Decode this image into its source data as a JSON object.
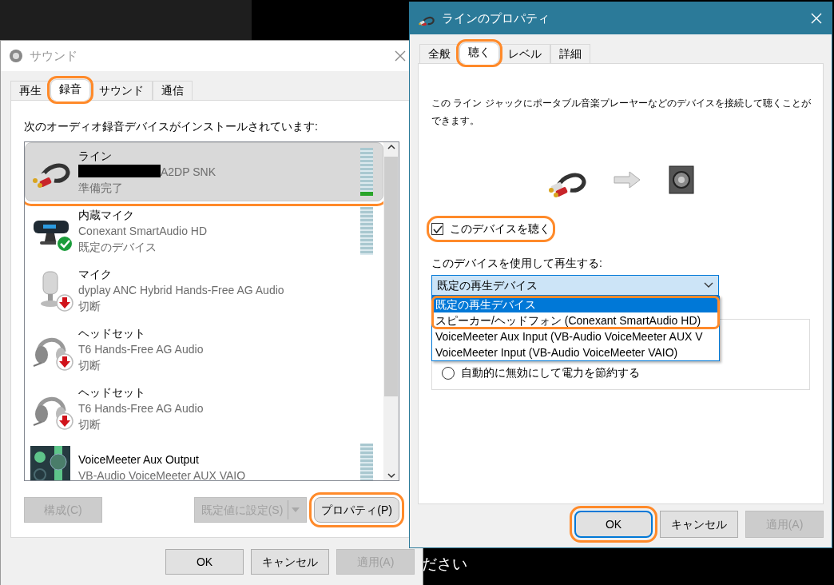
{
  "background_text": "ださい",
  "sound_window": {
    "title": "サウンド",
    "tabs": [
      {
        "label": "再生",
        "selected": false,
        "highlighted": false
      },
      {
        "label": "録音",
        "selected": true,
        "highlighted": true
      },
      {
        "label": "サウンド",
        "selected": false,
        "highlighted": false
      },
      {
        "label": "通信",
        "selected": false,
        "highlighted": false
      }
    ],
    "instruction": "次のオーディオ録音デバイスがインストールされています:",
    "devices": [
      {
        "kind": "line",
        "name": "ライン",
        "description": "A2DP SNK",
        "redacted": true,
        "status": "準備完了",
        "default_device": false,
        "disconnected": false,
        "level": 0.08,
        "selected": true,
        "highlighted": true
      },
      {
        "kind": "webcam",
        "name": "内蔵マイク",
        "description": "Conexant SmartAudio HD",
        "status": "既定のデバイス",
        "default_device": true,
        "disconnected": false,
        "level": 0,
        "selected": false,
        "highlighted": false
      },
      {
        "kind": "mic",
        "name": "マイク",
        "description": "dyplay ANC Hybrid Hands-Free AG Audio",
        "status": "切断",
        "default_device": false,
        "disconnected": true,
        "selected": false,
        "highlighted": false
      },
      {
        "kind": "headset",
        "name": "ヘッドセット",
        "description": "T6 Hands-Free AG Audio",
        "status": "切断",
        "default_device": false,
        "disconnected": true,
        "selected": false,
        "highlighted": false
      },
      {
        "kind": "headset",
        "name": "ヘッドセット",
        "description": "T6 Hands-Free AG Audio",
        "status": "切断",
        "default_device": false,
        "disconnected": true,
        "selected": false,
        "highlighted": false
      },
      {
        "kind": "mixer",
        "name": "VoiceMeeter Aux Output",
        "description": "VB-Audio VoiceMeeter AUX VAIO",
        "default_device": false,
        "disconnected": false,
        "level": 0,
        "selected": false,
        "highlighted": false
      }
    ],
    "list_buttons": [
      {
        "label": "構成(C)",
        "kind": "plain",
        "disabled": true,
        "highlighted": false
      },
      {
        "label": "既定値に設定(S)",
        "kind": "split",
        "disabled": true,
        "highlighted": false
      },
      {
        "label": "プロパティ(P)",
        "kind": "plain",
        "disabled": false,
        "highlighted": true
      }
    ],
    "dialog_buttons": [
      {
        "label": "OK",
        "disabled": false,
        "default": false,
        "highlighted": false
      },
      {
        "label": "キャンセル",
        "disabled": false,
        "default": false,
        "highlighted": false
      },
      {
        "label": "適用(A)",
        "disabled": true,
        "default": false,
        "highlighted": false
      }
    ]
  },
  "properties_window": {
    "title": "ラインのプロパティ",
    "tabs": [
      {
        "label": "全般",
        "selected": false,
        "highlighted": false
      },
      {
        "label": "聴く",
        "selected": true,
        "highlighted": true
      },
      {
        "label": "レベル",
        "selected": false,
        "highlighted": false
      },
      {
        "label": "詳細",
        "selected": false,
        "highlighted": false
      }
    ],
    "description": "この ライン ジャックにポータブル音楽プレーヤーなどのデバイスを接続して聴くことができます。",
    "listen_checkbox": {
      "label": "このデバイスを聴く",
      "checked": true,
      "highlighted": true
    },
    "playback_label": "このデバイスを使用して再生する:",
    "playback_dropdown": {
      "value": "既定の再生デバイス",
      "open": true,
      "options": [
        {
          "label": "既定の再生デバイス",
          "selected": true,
          "highlighted": true
        },
        {
          "label": "スピーカー/ヘッドフォン (Conexant SmartAudio HD)",
          "selected": false,
          "highlighted": true
        },
        {
          "label": "VoiceMeeter Aux Input (VB-Audio VoiceMeeter AUX V",
          "selected": false,
          "highlighted": false
        },
        {
          "label": "VoiceMeeter Input (VB-Audio VoiceMeeter VAIO)",
          "selected": false,
          "highlighted": false
        }
      ]
    },
    "power_radio": {
      "label": "自動的に無効にして電力を節約する",
      "selected": false
    },
    "buttons": [
      {
        "label": "OK",
        "disabled": false,
        "default": true,
        "highlighted": true
      },
      {
        "label": "キャンセル",
        "disabled": false,
        "default": false,
        "highlighted": false
      },
      {
        "label": "適用(A)",
        "disabled": true,
        "default": false,
        "highlighted": false
      }
    ]
  }
}
